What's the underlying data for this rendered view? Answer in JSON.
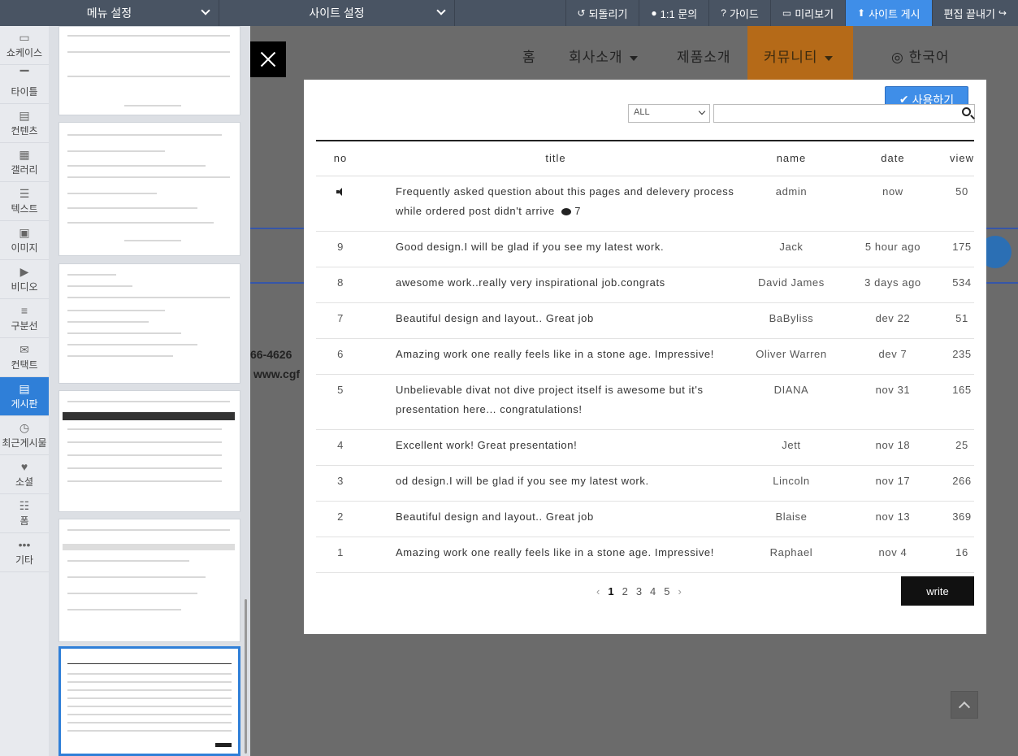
{
  "topbar": {
    "menu_settings": "메뉴 설정",
    "site_settings": "사이트 설정",
    "undo": "되돌리기",
    "inquiry": "1:1 문의",
    "guide": "가이드",
    "preview": "미리보기",
    "publish": "사이트 게시",
    "finish": "편집 끝내기",
    "accent_color": "#3f8ee8"
  },
  "rail": {
    "items": [
      {
        "label": "쇼케이스",
        "icon": "showcase-icon"
      },
      {
        "label": "타이틀",
        "icon": "title-icon"
      },
      {
        "label": "컨텐츠",
        "icon": "contents-icon"
      },
      {
        "label": "갤러리",
        "icon": "gallery-icon"
      },
      {
        "label": "텍스트",
        "icon": "text-icon"
      },
      {
        "label": "이미지",
        "icon": "image-icon"
      },
      {
        "label": "비디오",
        "icon": "video-icon"
      },
      {
        "label": "구분선",
        "icon": "divider-icon"
      },
      {
        "label": "컨택트",
        "icon": "mail-icon"
      },
      {
        "label": "게시판",
        "icon": "board-icon"
      },
      {
        "label": "최근게시물",
        "icon": "recent-posts-icon"
      },
      {
        "label": "소셜",
        "icon": "social-icon"
      },
      {
        "label": "폼",
        "icon": "form-icon"
      },
      {
        "label": "기타",
        "icon": "more-icon"
      }
    ],
    "active_index": 9
  },
  "site": {
    "nav": {
      "home": "홈",
      "about": "회사소개",
      "products": "제품소개",
      "community": "커뮤니티",
      "language": "한국어"
    },
    "phone_fragment": "66-4626",
    "url_fragment": "www.cgf"
  },
  "modal": {
    "use_button": "사용하기",
    "search": {
      "filter_value": "ALL",
      "query": ""
    },
    "columns": [
      "no",
      "title",
      "name",
      "date",
      "view"
    ],
    "rows": [
      {
        "no": "",
        "notice": true,
        "title": "Frequently asked question about this pages and delevery process while ordered post didn't arrive",
        "comments": "7",
        "name": "admin",
        "date": "now",
        "view": "50"
      },
      {
        "no": "9",
        "title": "Good design.I will be glad if you see my latest work.",
        "name": "Jack",
        "date": "5 hour ago",
        "view": "175"
      },
      {
        "no": "8",
        "title": "awesome work..really very inspirational job.congrats",
        "name": "David James",
        "date": "3 days ago",
        "view": "534"
      },
      {
        "no": "7",
        "title": "Beautiful design and layout.. Great job",
        "name": "BaByliss",
        "date": "dev 22",
        "view": "51"
      },
      {
        "no": "6",
        "title": "Amazing work one really feels like in a stone age. Impressive!",
        "name": "Oliver Warren",
        "date": "dev 7",
        "view": "235"
      },
      {
        "no": "5",
        "title": "Unbelievable divat not dive project itself is awesome but it's presentation here... congratulations!",
        "name": "DIANA",
        "date": "nov 31",
        "view": "165"
      },
      {
        "no": "4",
        "title": "Excellent work! Great presentation!",
        "name": "Jett",
        "date": "nov 18",
        "view": "25"
      },
      {
        "no": "3",
        "title": "od design.I will be glad if you see my latest work.",
        "name": "Lincoln",
        "date": "nov 17",
        "view": "266"
      },
      {
        "no": "2",
        "title": "Beautiful design and layout.. Great job",
        "name": "Blaise",
        "date": "nov 13",
        "view": "369"
      },
      {
        "no": "1",
        "title": "Amazing work one really feels like in a stone age. Impressive!",
        "name": "Raphael",
        "date": "nov 4",
        "view": "16"
      }
    ],
    "pagination": {
      "prev": "‹",
      "pages": [
        "1",
        "2",
        "3",
        "4",
        "5"
      ],
      "current": "1",
      "next": "›"
    },
    "write_button": "write"
  }
}
